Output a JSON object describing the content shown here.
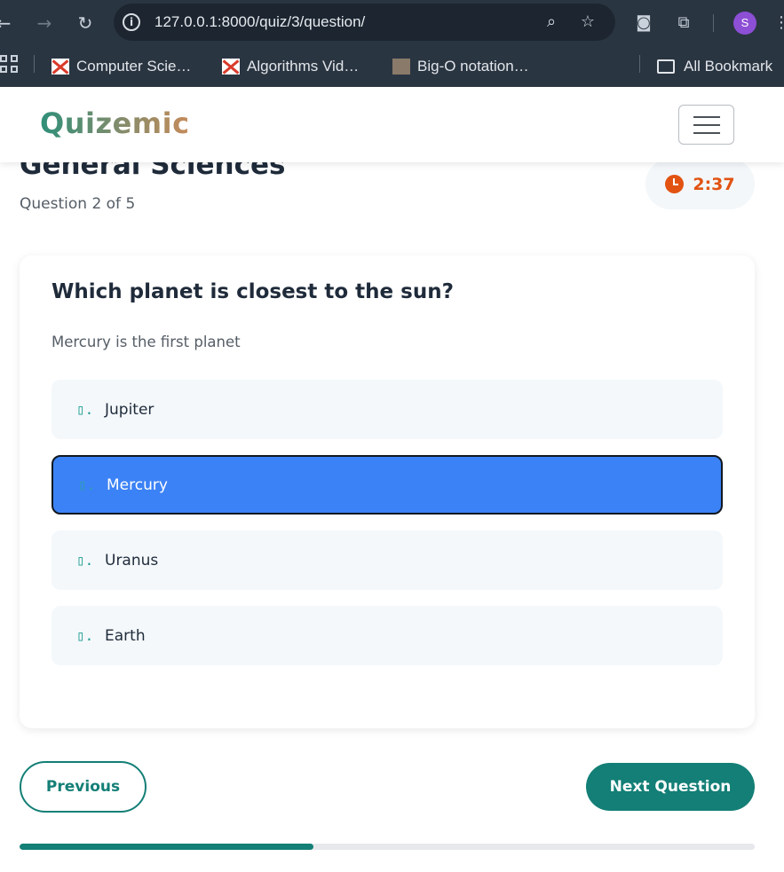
{
  "browser": {
    "url": "127.0.0.1:8000/quiz/3/question/",
    "profile_initial": "S",
    "bookmarks": [
      {
        "label": "Computer Scie…"
      },
      {
        "label": "Algorithms Vid…"
      },
      {
        "label": "Big-O notation…"
      }
    ],
    "all_bookmarks_label": "All Bookmark"
  },
  "navbar": {
    "brand": "Quizemic"
  },
  "quiz": {
    "title": "General Sciences",
    "progress_text": "Question 2 of 5",
    "timer": "2:37",
    "question": "Which planet is closest to the sun?",
    "hint": "Mercury is the first planet",
    "options": [
      {
        "letter": "▯.",
        "label": "Jupiter",
        "selected": false
      },
      {
        "letter": "▯.",
        "label": "Mercury",
        "selected": true
      },
      {
        "letter": "▯.",
        "label": "Uranus",
        "selected": false
      },
      {
        "letter": "▯.",
        "label": "Earth",
        "selected": false
      }
    ],
    "previous_label": "Previous",
    "next_label": "Next Question",
    "progress_fraction": 0.4
  },
  "colors": {
    "accent": "#137f76",
    "selected_option": "#3b82f6",
    "timer": "#e25312"
  }
}
